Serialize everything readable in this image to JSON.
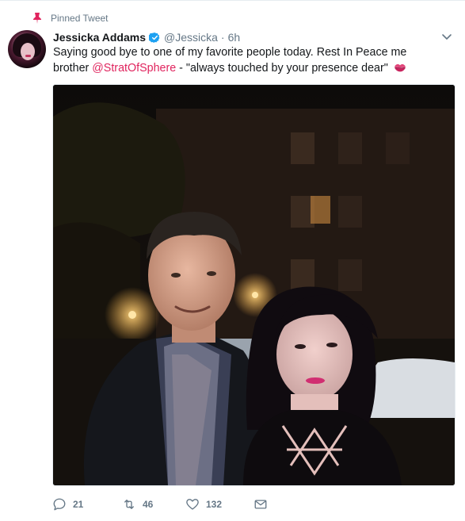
{
  "pinned_label": "Pinned Tweet",
  "author": {
    "name": "Jessicka Addams",
    "handle": "@Jessicka",
    "time": "6h"
  },
  "tweet": {
    "text_before": "Saying good bye to one of my favorite people today. Rest In Peace me brother ",
    "mention": "@StratOfSphere",
    "text_after": "  - \"always touched by your presence dear\""
  },
  "actions": {
    "replies": "21",
    "retweets": "46",
    "likes": "132"
  },
  "icons": {
    "pin": "pin-icon",
    "verified": "verified-badge-icon",
    "caret": "chevron-down-icon",
    "emoji": "kiss-mark-emoji",
    "reply": "reply-icon",
    "retweet": "retweet-icon",
    "like": "heart-icon",
    "dm": "envelope-icon"
  },
  "colors": {
    "accent": "#e0245e",
    "verified": "#1da1f2",
    "secondary_text": "#657786",
    "text": "#14171a"
  }
}
